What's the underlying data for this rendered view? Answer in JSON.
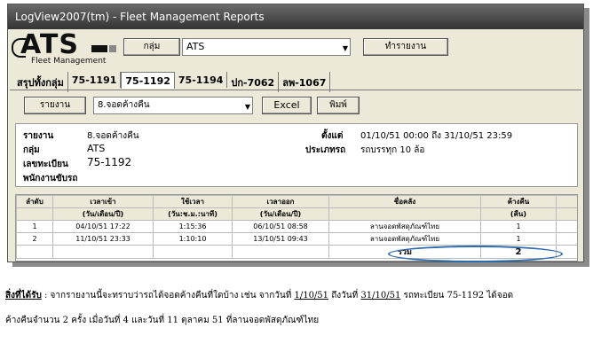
{
  "window": {
    "title": "LogView2007(tm) - Fleet Management Reports"
  },
  "logo": {
    "brand": "ATS",
    "subtitle": "Fleet Management"
  },
  "toolbar": {
    "group_button": "กลุ่ม",
    "group_value": "ATS",
    "run_button": "ทำรายงาน",
    "report_button": "รายงาน",
    "report_value": "8.จอดค้างคืน",
    "excel_button": "Excel",
    "print_button": "พิมพ์"
  },
  "tabs": [
    {
      "label": "สรุปทั้งกลุ่ม",
      "active": false
    },
    {
      "label": "75-1191",
      "active": false
    },
    {
      "label": "75-1192",
      "active": true
    },
    {
      "label": "75-1194",
      "active": false
    },
    {
      "label": "ปก-7062",
      "active": false
    },
    {
      "label": "ลพ-1067",
      "active": false
    }
  ],
  "info": {
    "report_label": "รายงาน",
    "report_value": "8.จอดค้างคืน",
    "group_label": "กลุ่ม",
    "group_value": "ATS",
    "plate_label": "เลขทะเบียน",
    "plate_value": "75-1192",
    "driver_label": "พนักงานขับรถ",
    "driver_value": "",
    "from_label": "ตั้งแต่",
    "from_value": "01/10/51  00:00 ถึง 31/10/51  23:59",
    "type_label": "ประเภทรถ",
    "type_value": "รถบรรทุก 10 ล้อ"
  },
  "table": {
    "headers_top": [
      "ลำดับ",
      "เวลาเข้า",
      "ใช้เวลา",
      "เวลาออก",
      "ชื่อคลัง",
      "ค้างคืน"
    ],
    "headers_sub": [
      "",
      "(วัน/เดือน/ปี)",
      "(วัน:ช.ม.:นาที)",
      "(วัน/เดือน/ปี)",
      "",
      "(คืน)"
    ],
    "rows": [
      {
        "no": "1",
        "in": "04/10/51  17:22",
        "dur": "1:15:36",
        "out": "06/10/51  08:58",
        "depot": "ลานจอดพัสดุภัณฑ์ไทย",
        "nights": "1"
      },
      {
        "no": "2",
        "in": "11/10/51  23:33",
        "dur": "1:10:10",
        "out": "13/10/51  09:43",
        "depot": "ลานจอดพัสดุภัณฑ์ไทย",
        "nights": "1"
      }
    ],
    "total_label": "รวม",
    "total_value": "2"
  },
  "caption": {
    "heading": "สิ่งที่ได้รับ",
    "p1": " : จากรายงานนี้จะทราบว่ารถได้จอดค้างคืนที่ใดบ้าง เช่น จากวันที่ ",
    "d1": "1/10/51",
    "p2": " ถึงวันที่ ",
    "d2": "31/10/51",
    "p3": " รถทะเบียน 75-1192 ได้จอด",
    "line2": "ค้างคืนจำนวน 2 ครั้ง เมื่อวันที่ 4 และวันที่ 11 ตุลาคม 51 ที่ลานจอดพัสดุภัณฑ์ไทย"
  }
}
